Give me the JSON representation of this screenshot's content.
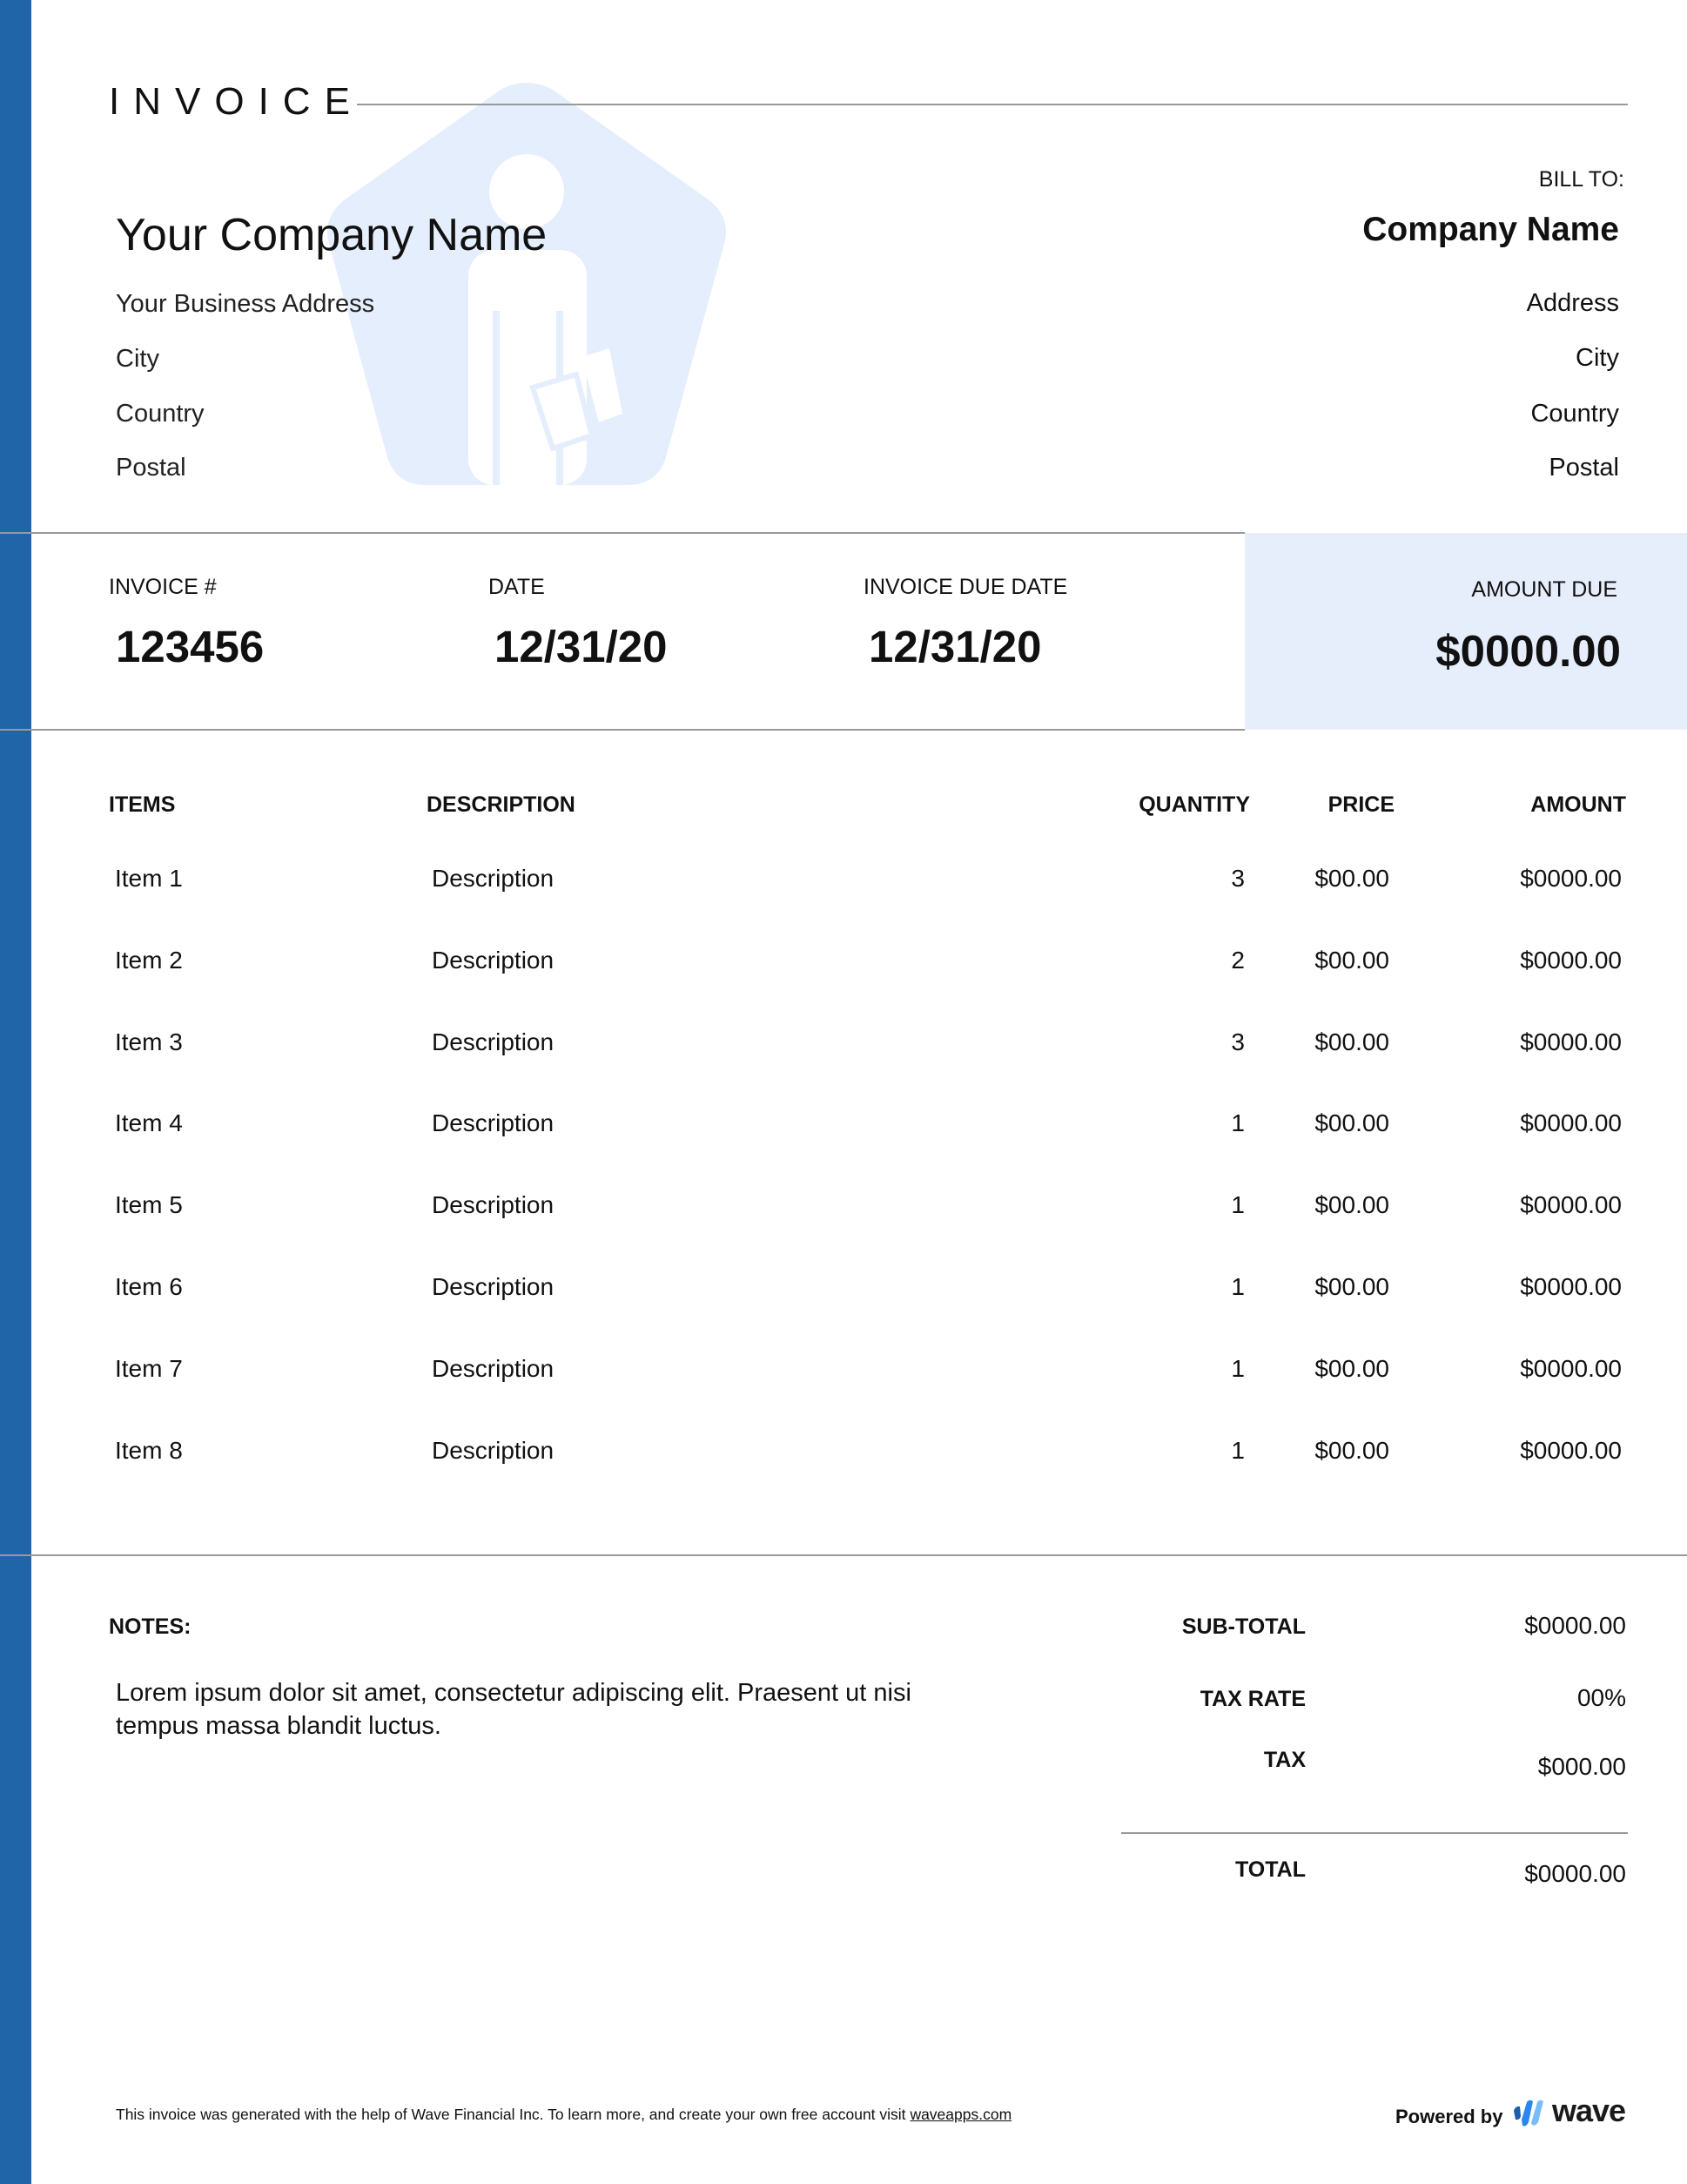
{
  "document": {
    "title": "INVOICE",
    "brand_color": "#2065a8",
    "highlight_color": "#e6eefc"
  },
  "sender": {
    "company_name": "Your Company Name",
    "address": "Your Business Address",
    "city": "City",
    "country": "Country",
    "postal": "Postal"
  },
  "bill_to": {
    "label": "BILL TO:",
    "company_name": "Company Name",
    "address": "Address",
    "city": "City",
    "country": "Country",
    "postal": "Postal"
  },
  "summary": {
    "invoice_number_label": "INVOICE #",
    "invoice_number": "123456",
    "date_label": "DATE",
    "date": "12/31/20",
    "due_date_label": "INVOICE DUE DATE",
    "due_date": "12/31/20",
    "amount_due_label": "AMOUNT DUE",
    "amount_due": "$0000.00"
  },
  "table": {
    "headers": {
      "items": "ITEMS",
      "description": "DESCRIPTION",
      "quantity": "QUANTITY",
      "price": "PRICE",
      "amount": "AMOUNT"
    },
    "rows": [
      {
        "item": "Item 1",
        "description": "Description",
        "quantity": "3",
        "price": "$00.00",
        "amount": "$0000.00"
      },
      {
        "item": "Item 2",
        "description": "Description",
        "quantity": "2",
        "price": "$00.00",
        "amount": "$0000.00"
      },
      {
        "item": "Item 3",
        "description": "Description",
        "quantity": "3",
        "price": "$00.00",
        "amount": "$0000.00"
      },
      {
        "item": "Item 4",
        "description": "Description",
        "quantity": "1",
        "price": "$00.00",
        "amount": "$0000.00"
      },
      {
        "item": "Item 5",
        "description": "Description",
        "quantity": "1",
        "price": "$00.00",
        "amount": "$0000.00"
      },
      {
        "item": "Item 6",
        "description": "Description",
        "quantity": "1",
        "price": "$00.00",
        "amount": "$0000.00"
      },
      {
        "item": "Item 7",
        "description": "Description",
        "quantity": "1",
        "price": "$00.00",
        "amount": "$0000.00"
      },
      {
        "item": "Item 8",
        "description": "Description",
        "quantity": "1",
        "price": "$00.00",
        "amount": "$0000.00"
      }
    ]
  },
  "notes": {
    "label": "NOTES:",
    "text": "Lorem ipsum dolor sit amet, consectetur adipiscing elit. Praesent ut nisi tempus massa blandit luctus."
  },
  "totals": {
    "subtotal_label": "SUB-TOTAL",
    "subtotal": "$0000.00",
    "tax_rate_label": "TAX RATE",
    "tax_rate": "00%",
    "tax_label": "TAX",
    "tax": "$000.00",
    "total_label": "TOTAL",
    "total": "$0000.00"
  },
  "footer": {
    "text": "This invoice was generated with the help of Wave Financial Inc. To learn more, and create your own free account visit",
    "link_text": "waveapps.com",
    "powered_by": "Powered by",
    "brand_word": "wave",
    "logo_icon": "wave-logo-icon"
  }
}
